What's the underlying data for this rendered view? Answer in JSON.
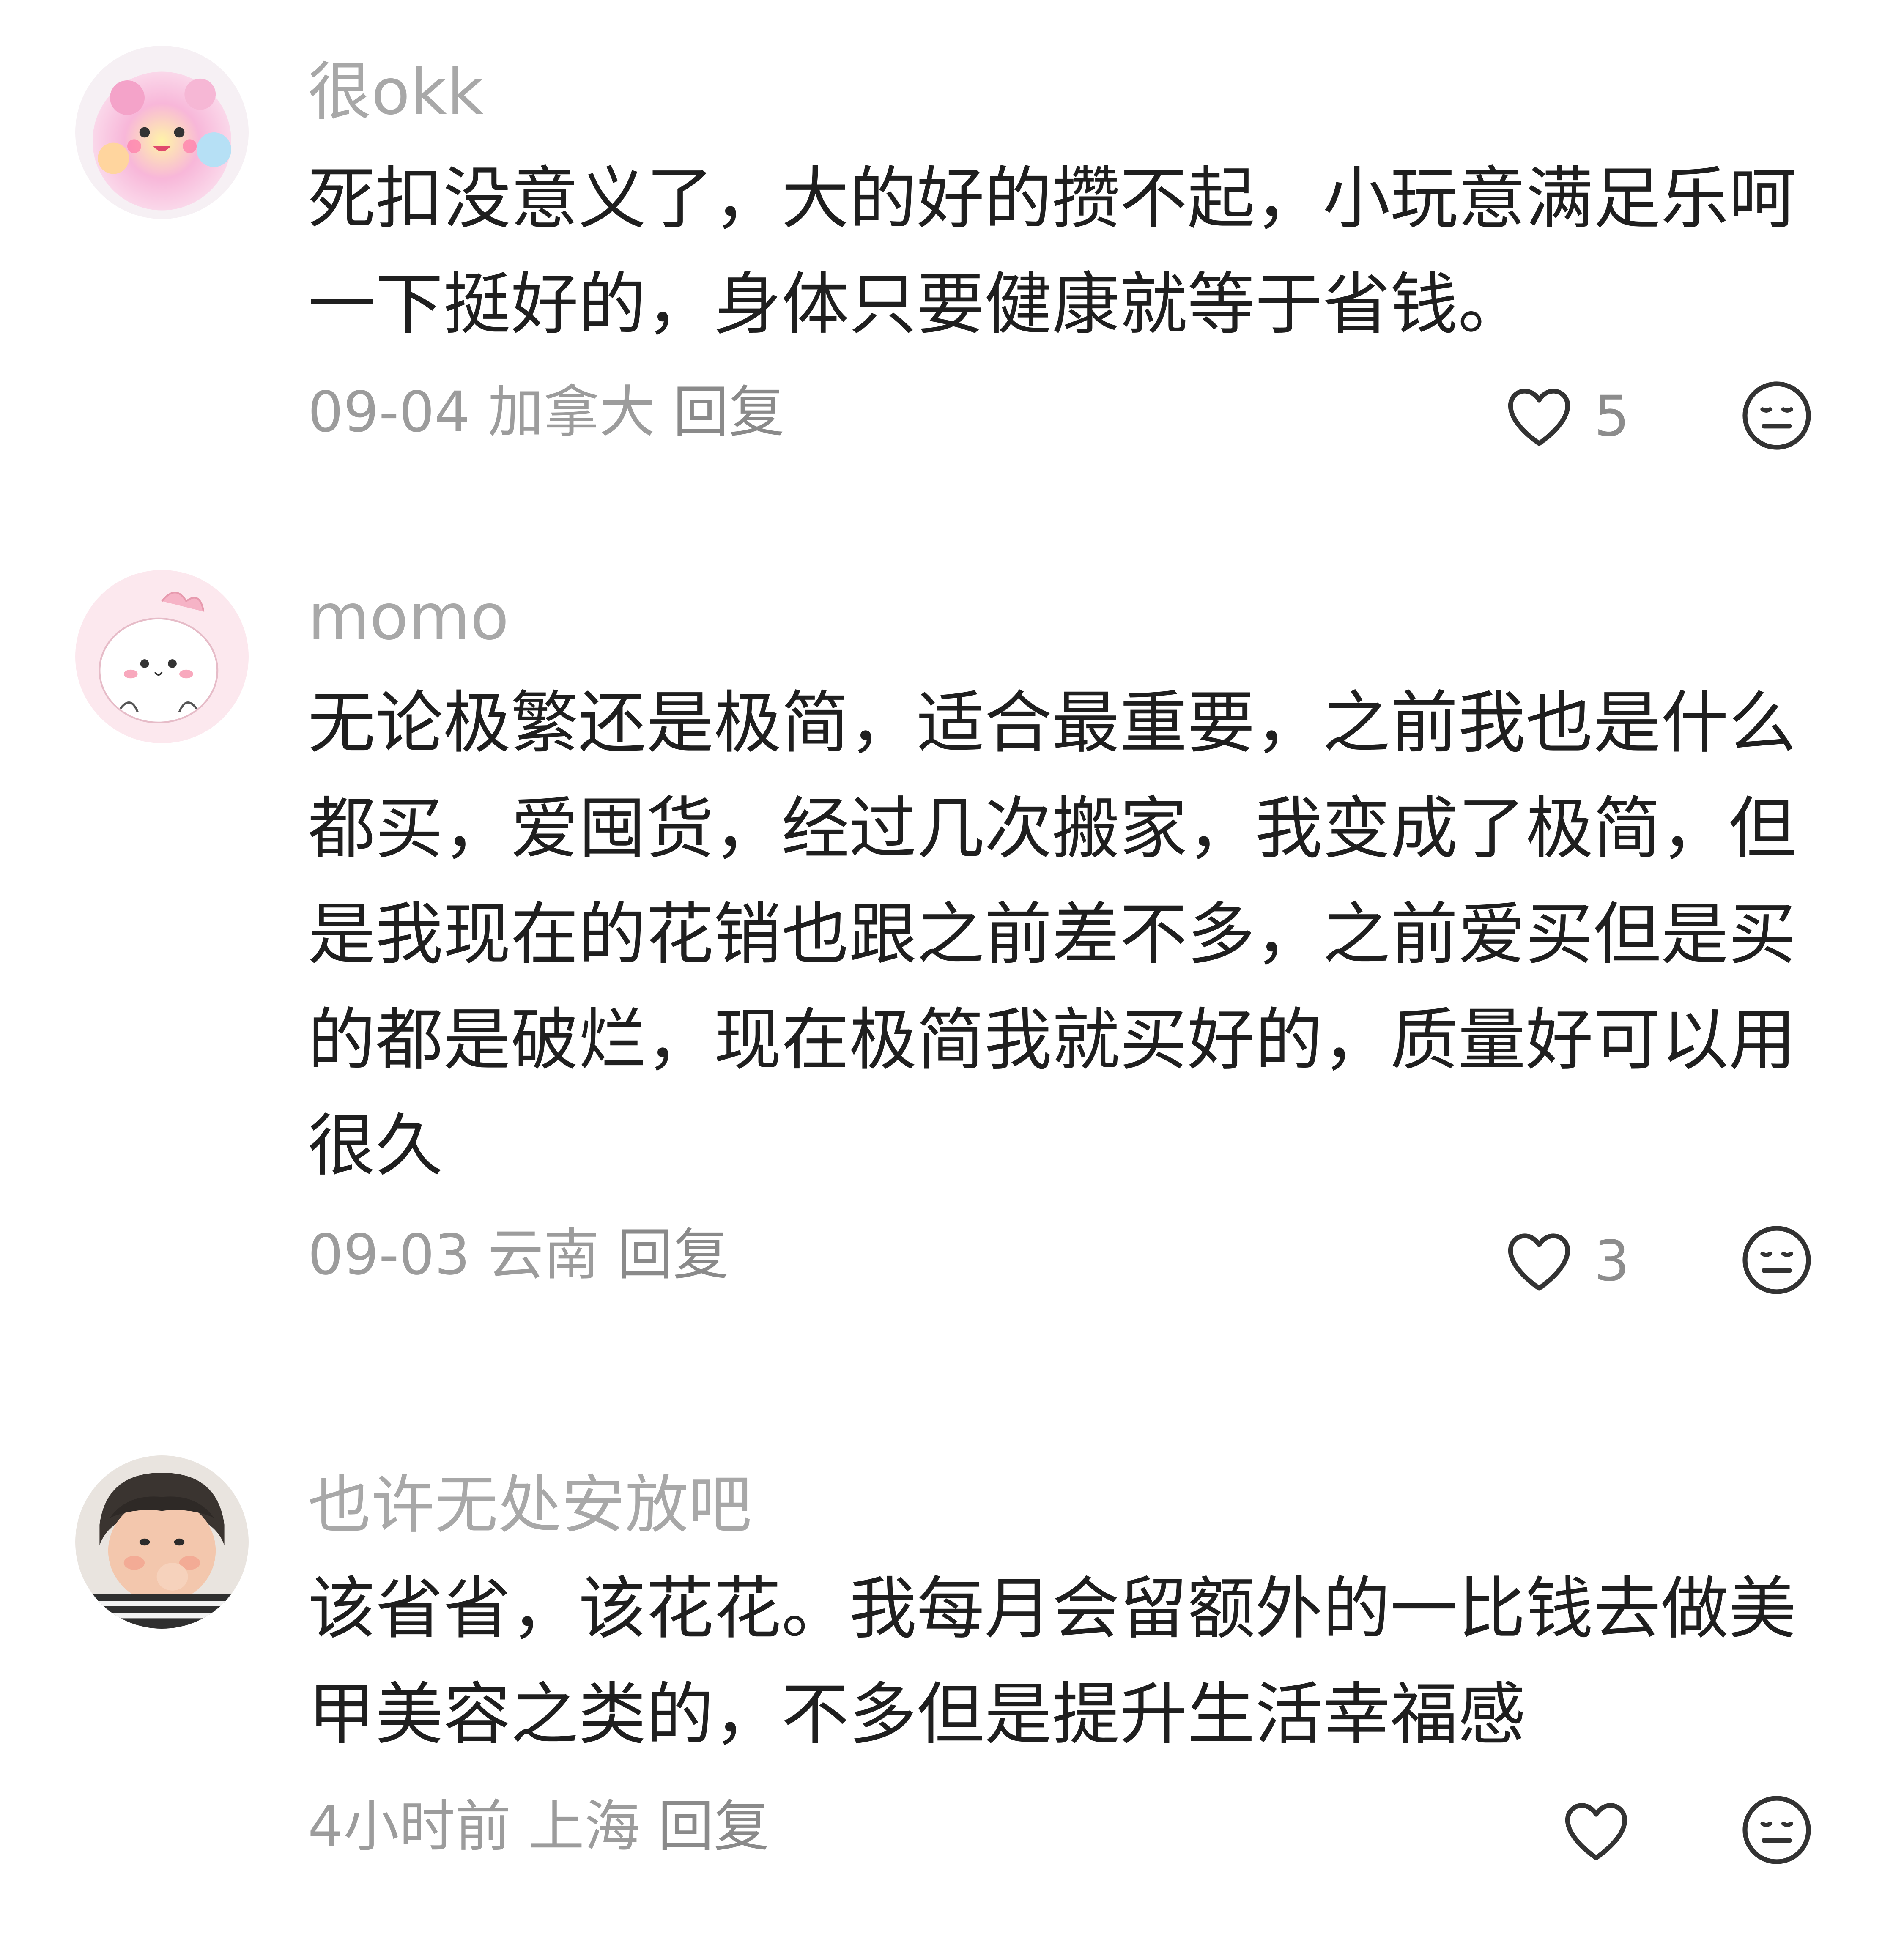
{
  "comments": [
    {
      "username": "很okk",
      "content": "死扣没意义了，大的好的攒不起，小玩意满足乐呵一下挺好的，身体只要健康就等于省钱。",
      "date": "09-04",
      "location": "加拿大",
      "reply_label": "回复",
      "likes": "5",
      "avatar_icon": "pink-cartoon-avatar-icon"
    },
    {
      "username": "momo",
      "content": "无论极繁还是极简，适合最重要，之前我也是什么都买，爱囤货，经过几次搬家，我变成了极简，但是我现在的花销也跟之前差不多，之前爱买但是买的都是破烂，现在极简我就买好的，质量好可以用很久",
      "date": "09-03",
      "location": "云南",
      "reply_label": "回复",
      "likes": "3",
      "avatar_icon": "cute-bun-avatar-icon"
    },
    {
      "username": "也许无处安放吧",
      "content": "该省省，该花花。我每月会留额外的一比钱去做美甲美容之类的，不多但是提升生活幸福感",
      "date": "4小时前",
      "location": "上海",
      "reply_label": "回复",
      "likes": "",
      "avatar_icon": "child-photo-avatar-icon"
    }
  ],
  "icons": {
    "like": "heart-outline-icon",
    "dislike": "neutral-face-icon"
  },
  "colors": {
    "username": "#a8a8a8",
    "content": "#1f1f1f",
    "meta": "#9c9c9c",
    "icon": "#333333"
  }
}
